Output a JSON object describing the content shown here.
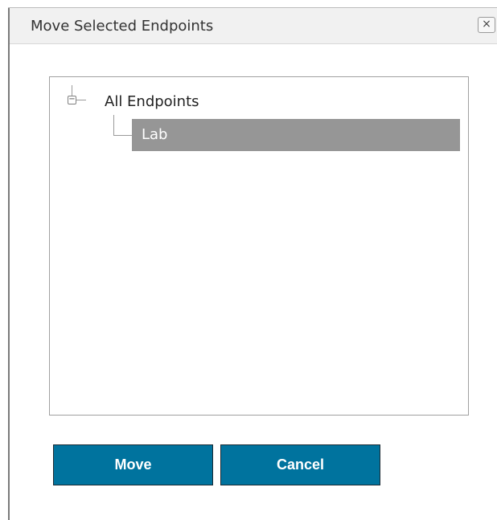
{
  "dialog": {
    "title": "Move Selected Endpoints",
    "close_glyph": "×"
  },
  "tree": {
    "toggle_glyph": "−",
    "root": {
      "label": "All Endpoints",
      "icon": "collapse-icon",
      "expanded": true
    },
    "children": [
      {
        "label": "Lab",
        "selected": true
      }
    ]
  },
  "buttons": {
    "move_label": "Move",
    "cancel_label": "Cancel"
  },
  "colors": {
    "button_bg": "#00739e",
    "selected_bg": "#969696"
  }
}
